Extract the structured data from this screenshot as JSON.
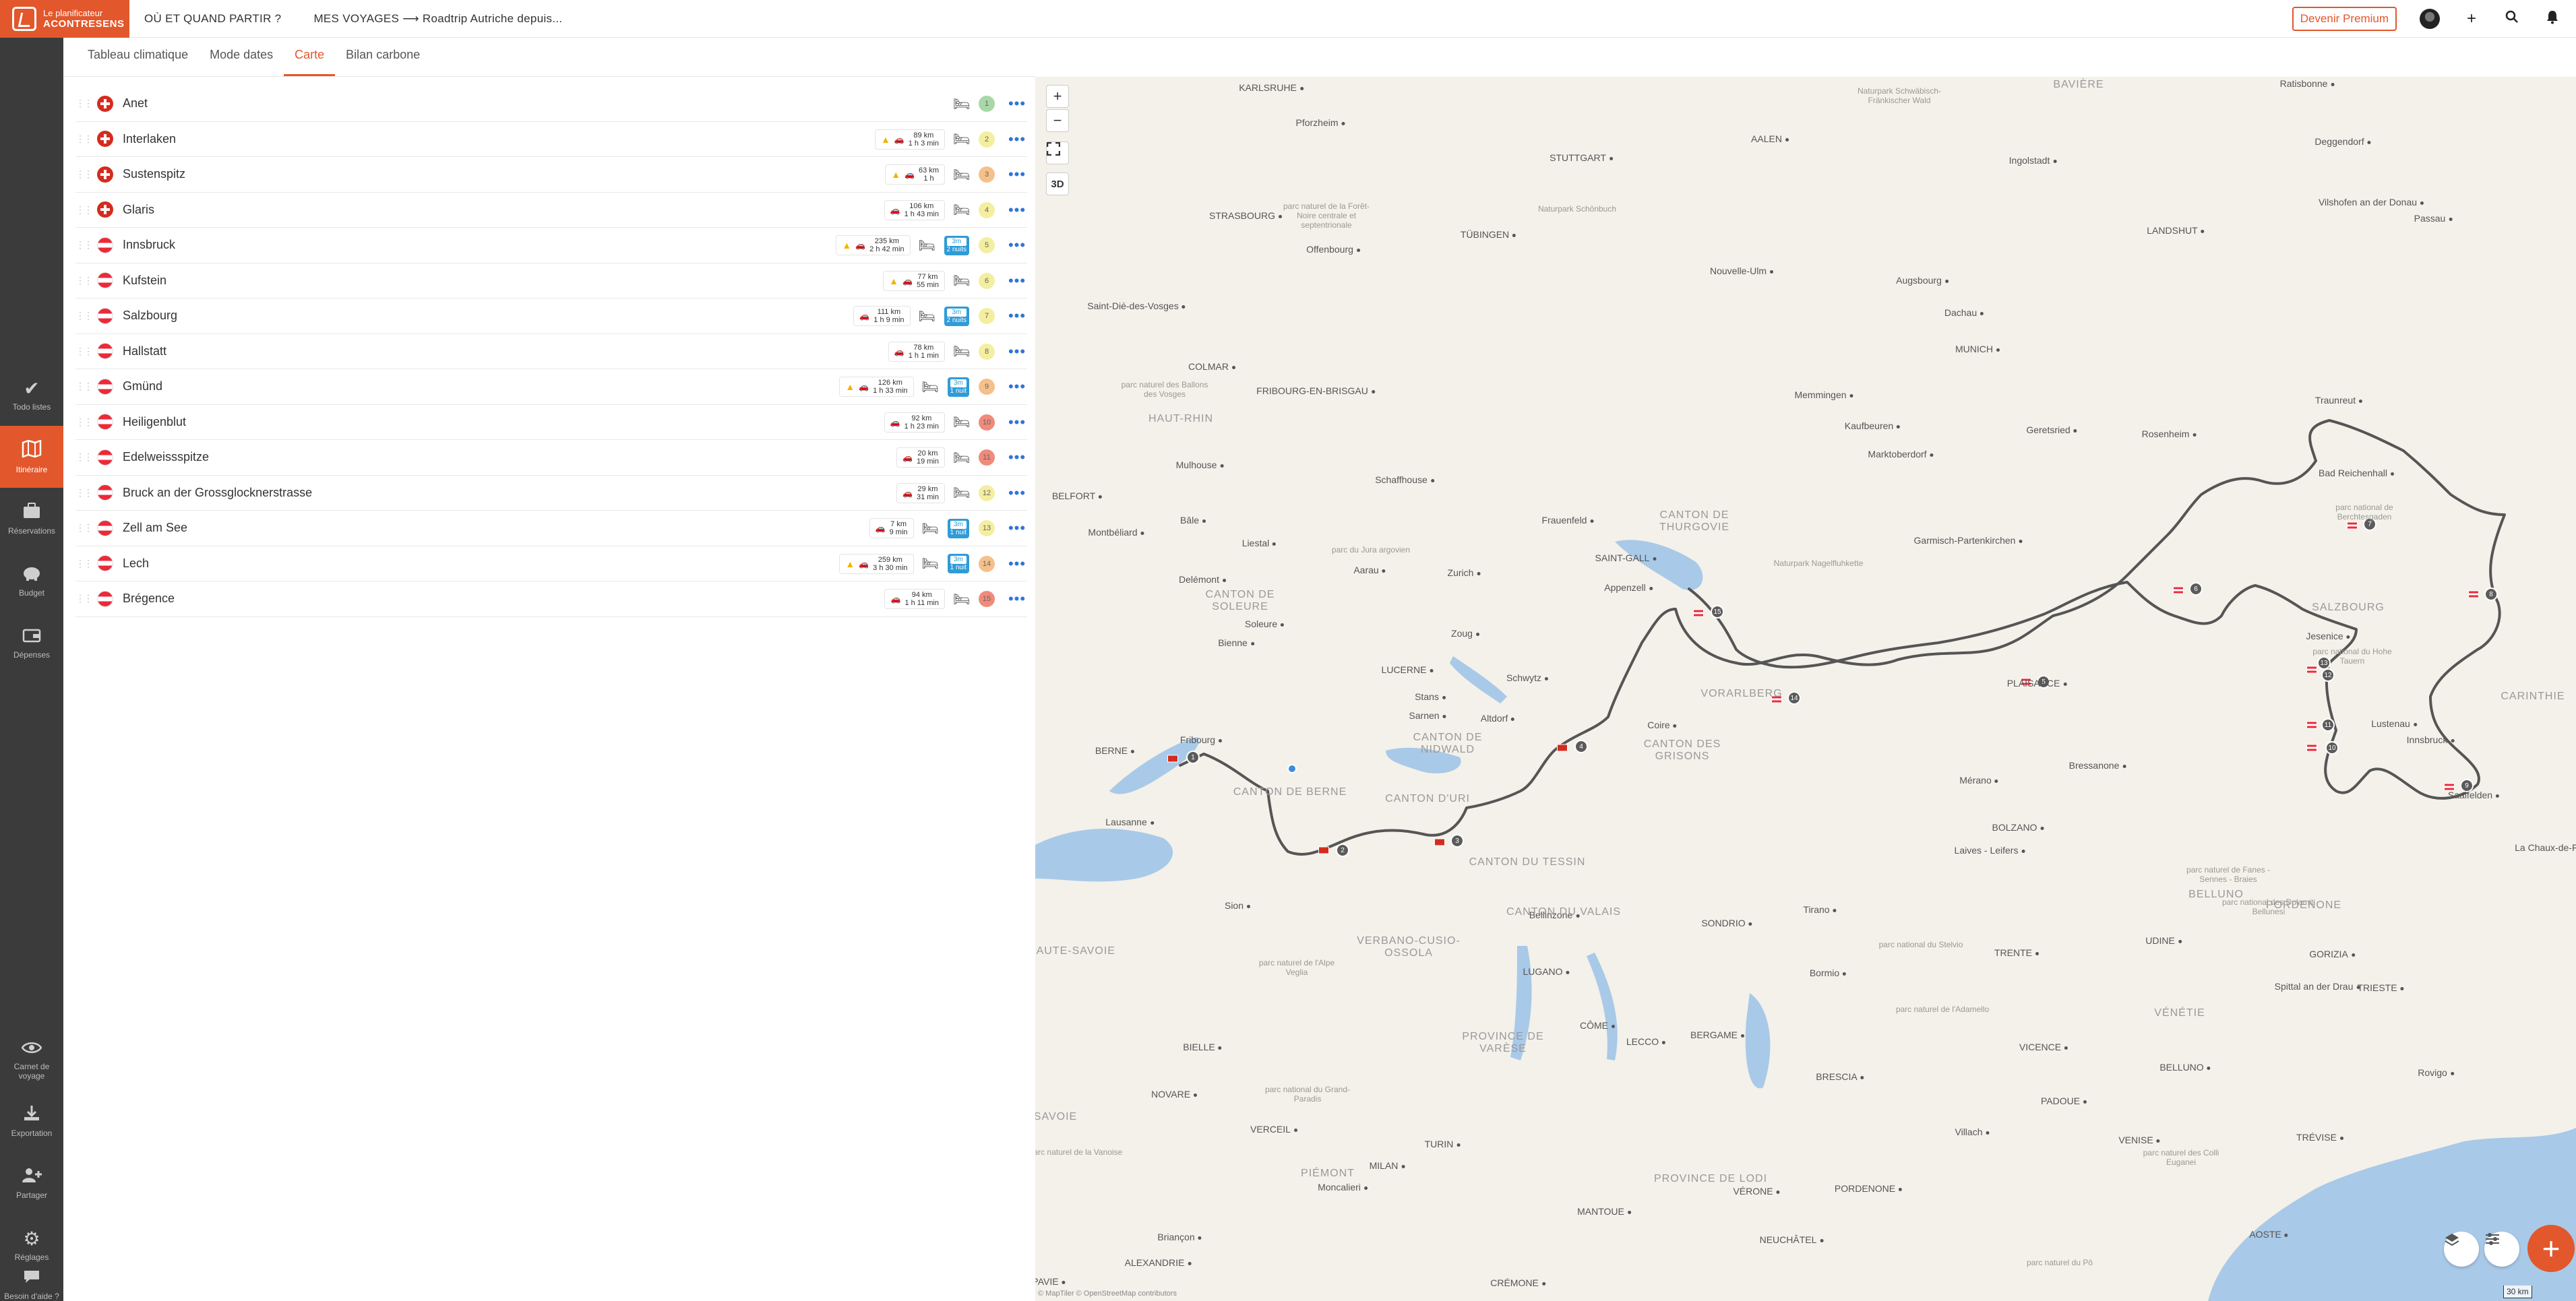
{
  "header": {
    "logo_line1": "Le planificateur",
    "logo_line2": "ACONTRESENS",
    "nav_when": "OÙ ET QUAND PARTIR ?",
    "nav_trips": "MES VOYAGES ⟶ Roadtrip Autriche depuis...",
    "premium_label": "Devenir Premium",
    "icons": [
      "avatar",
      "plus-icon",
      "search-icon",
      "bell-icon"
    ]
  },
  "sidebar": {
    "items": [
      {
        "label": "Todo listes",
        "icon": "check-icon"
      },
      {
        "label": "Itinéraire",
        "icon": "map-icon",
        "active": true
      },
      {
        "label": "Réservations",
        "icon": "suitcase-icon"
      },
      {
        "label": "Budget",
        "icon": "piggy-bank-icon"
      },
      {
        "label": "Dépenses",
        "icon": "wallet-icon"
      },
      {
        "label": "Carnet de voyage",
        "icon": "eye-icon"
      },
      {
        "label": "Exportation",
        "icon": "download-icon"
      },
      {
        "label": "Partager",
        "icon": "add-user-icon"
      },
      {
        "label": "Réglages",
        "icon": "gear-icon"
      },
      {
        "label": "Besoin d'aide ?",
        "icon": "chat-icon"
      }
    ]
  },
  "tabs": [
    "Tableau climatique",
    "Mode dates",
    "Carte",
    "Bilan carbone"
  ],
  "active_tab": "Carte",
  "itinerary": [
    {
      "country": "ch",
      "city": "Anet",
      "leg": null,
      "nights": null,
      "badge": "1",
      "badge_color": "#a8d8a8"
    },
    {
      "country": "ch",
      "city": "Interlaken",
      "leg": {
        "warn": true,
        "km": "89 km",
        "time": "1 h 3 min"
      },
      "nights": null,
      "badge": "2",
      "badge_color": "#f4eea0"
    },
    {
      "country": "ch",
      "city": "Sustenspitz",
      "leg": {
        "warn": true,
        "km": "63 km",
        "time": "1 h"
      },
      "nights": null,
      "badge": "3",
      "badge_color": "#f6c08a"
    },
    {
      "country": "ch",
      "city": "Glaris",
      "leg": {
        "warn": false,
        "km": "106 km",
        "time": "1 h 43 min"
      },
      "nights": null,
      "badge": "4",
      "badge_color": "#f4eea0"
    },
    {
      "country": "at",
      "city": "Innsbruck",
      "leg": {
        "warn": true,
        "km": "235 km",
        "time": "2 h 42 min"
      },
      "nights": {
        "top": "3m",
        "bottom": "2 nuits"
      },
      "badge": "5",
      "badge_color": "#f4eea0"
    },
    {
      "country": "at",
      "city": "Kufstein",
      "leg": {
        "warn": true,
        "km": "77 km",
        "time": "55 min"
      },
      "nights": null,
      "badge": "6",
      "badge_color": "#f4eea0"
    },
    {
      "country": "at",
      "city": "Salzbourg",
      "leg": {
        "warn": false,
        "km": "111 km",
        "time": "1 h 9 min"
      },
      "nights": {
        "top": "3m",
        "bottom": "2 nuits"
      },
      "badge": "7",
      "badge_color": "#f4eea0"
    },
    {
      "country": "at",
      "city": "Hallstatt",
      "leg": {
        "warn": false,
        "km": "78 km",
        "time": "1 h 1 min"
      },
      "nights": null,
      "badge": "8",
      "badge_color": "#f4eea0"
    },
    {
      "country": "at",
      "city": "Gmünd",
      "leg": {
        "warn": true,
        "km": "126 km",
        "time": "1 h 33 min"
      },
      "nights": {
        "top": "3m",
        "bottom": "1 nuit"
      },
      "badge": "9",
      "badge_color": "#f6c08a"
    },
    {
      "country": "at",
      "city": "Heiligenblut",
      "leg": {
        "warn": false,
        "km": "92 km",
        "time": "1 h 23 min"
      },
      "nights": null,
      "badge": "10",
      "badge_color": "#f08a7a"
    },
    {
      "country": "at",
      "city": "Edelweissspitze",
      "leg": {
        "warn": false,
        "km": "20 km",
        "time": "19 min"
      },
      "nights": null,
      "badge": "11",
      "badge_color": "#f08a7a"
    },
    {
      "country": "at",
      "city": "Bruck an der Grossglocknerstrasse",
      "leg": {
        "warn": false,
        "km": "29 km",
        "time": "31 min"
      },
      "nights": null,
      "badge": "12",
      "badge_color": "#f4eea0"
    },
    {
      "country": "at",
      "city": "Zell am See",
      "leg": {
        "warn": false,
        "km": "7 km",
        "time": "9 min"
      },
      "nights": {
        "top": "3m",
        "bottom": "1 nuit"
      },
      "badge": "13",
      "badge_color": "#f4eea0"
    },
    {
      "country": "at",
      "city": "Lech",
      "leg": {
        "warn": true,
        "km": "259 km",
        "time": "3 h 30 min"
      },
      "nights": {
        "top": "3m",
        "bottom": "1 nuit"
      },
      "badge": "14",
      "badge_color": "#f6c08a"
    },
    {
      "country": "at",
      "city": "Brégence",
      "leg": {
        "warn": false,
        "km": "94 km",
        "time": "1 h 11 min"
      },
      "nights": null,
      "badge": "15",
      "badge_color": "#f08a7a"
    }
  ],
  "map": {
    "zoom_in": "+",
    "zoom_out": "−",
    "mode_3d": "3D",
    "scale": "30 km",
    "attribution": "© MapTiler © OpenStreetMap contributors",
    "route_color": "#555555",
    "accent": "#e2572b",
    "labels": {
      "cities": [
        "KARLSRUHE",
        "Pforzheim",
        "STUTTGART",
        "AALEN",
        "Ingolstadt",
        "Deggendorf",
        "Ratisbonne",
        "STRASBOURG",
        "Offenbourg",
        "TÜBINGEN",
        "Nouvelle-Ulm",
        "Augsbourg",
        "Dachau",
        "LANDSHUT",
        "Passau",
        "Vilshofen an der Donau",
        "Saint-Dié-des-Vosges",
        "COLMAR",
        "FRIBOURG-EN-BRISGAU",
        "Memmingen",
        "MUNICH",
        "Kaufbeuren",
        "Geretsried",
        "Rosenheim",
        "Traunreut",
        "Marktoberdorf",
        "Mulhouse",
        "Schaffhouse",
        "Bâle",
        "Liestal",
        "Frauenfeld",
        "SAINT-GALL",
        "Garmisch-Partenkirchen",
        "Bad Reichenhall",
        "Delémont",
        "Aarau",
        "Zurich",
        "Appenzell",
        "Montbéliard",
        "BELFORT",
        "Soleure",
        "Zoug",
        "Schwytz",
        "Bienne",
        "LUCERNE",
        "Stans",
        "Sarnen",
        "Altdorf",
        "Coire",
        "Fribourg",
        "Lausanne",
        "Sion",
        "Bellinzone",
        "LUGANO",
        "CÔME",
        "LECCO",
        "BERGAME",
        "SONDRIO",
        "Tirano",
        "Bormio",
        "Mérano",
        "BOLZANO",
        "Laives - Leifers",
        "Bressanone",
        "TRENTE",
        "BRESCIA",
        "VICENCE",
        "PADOUE",
        "VENISE",
        "TRÉVISE",
        "BELLUNO",
        "UDINE",
        "GORIZIA",
        "TRIESTE",
        "Rovigo",
        "AOSTE",
        "BIELLE",
        "NOVARE",
        "VERCEIL",
        "MILAN",
        "TURIN",
        "Moncalieri",
        "Briançon",
        "ALEXANDRIE",
        "PAVIE",
        "CRÉMONE",
        "MANTOUE",
        "VÉRONE",
        "PORDENONE",
        "Villach",
        "Spittal an der Drau",
        "Saalfelden",
        "Innsbruck",
        "Lustenau",
        "Jesenice",
        "PLAISANCE",
        "La Chaux-de-Fonds",
        "NEUCHÂTEL",
        "BERNE"
      ],
      "regions": [
        "CANTON DE THURGOVIE",
        "CANTON DE SOLEURE",
        "CANTON DE BERNE",
        "CANTON DE NIDWALD",
        "CANTON D'URI",
        "CANTON DES GRISONS",
        "CANTON DU TESSIN",
        "CANTON DU VALAIS",
        "VORARLBERG",
        "SALZBOURG",
        "CARINTHIE",
        "HAUT-RHIN",
        "BAVIÈRE",
        "VERBANO-CUSIO-OSSOLA",
        "PROVINCE DE VARÈSE",
        "PROVINCE DE LODI",
        "PIÉMONT",
        "VÉNÉTIE",
        "HAUTE-SAVOIE",
        "SAVOIE",
        "BELLUNO",
        "PORDENONE"
      ],
      "parks": [
        "Naturpark Schwäbisch-Fränkischer Wald",
        "parc naturel de la Forêt-Noire centrale et septentrionale",
        "Naturpark Schönbuch",
        "parc naturel des Ballons des Vosges",
        "parc du Jura argovien",
        "Naturpark Nagelfluhkette",
        "parc national de Berchtesgaden",
        "parc national du Hohe Tauern",
        "parc naturel de l'Alpe Veglia",
        "parc national du Grand-Paradis",
        "parc naturel de la Vanoise",
        "parc naturel de Fanes - Sennes - Braies",
        "parc national des Dolomiti Bellunesi",
        "parc national du Stelvio",
        "parc naturel de l'Adamello",
        "parc naturel des Colli Euganei",
        "parc naturel du Pô"
      ]
    }
  }
}
